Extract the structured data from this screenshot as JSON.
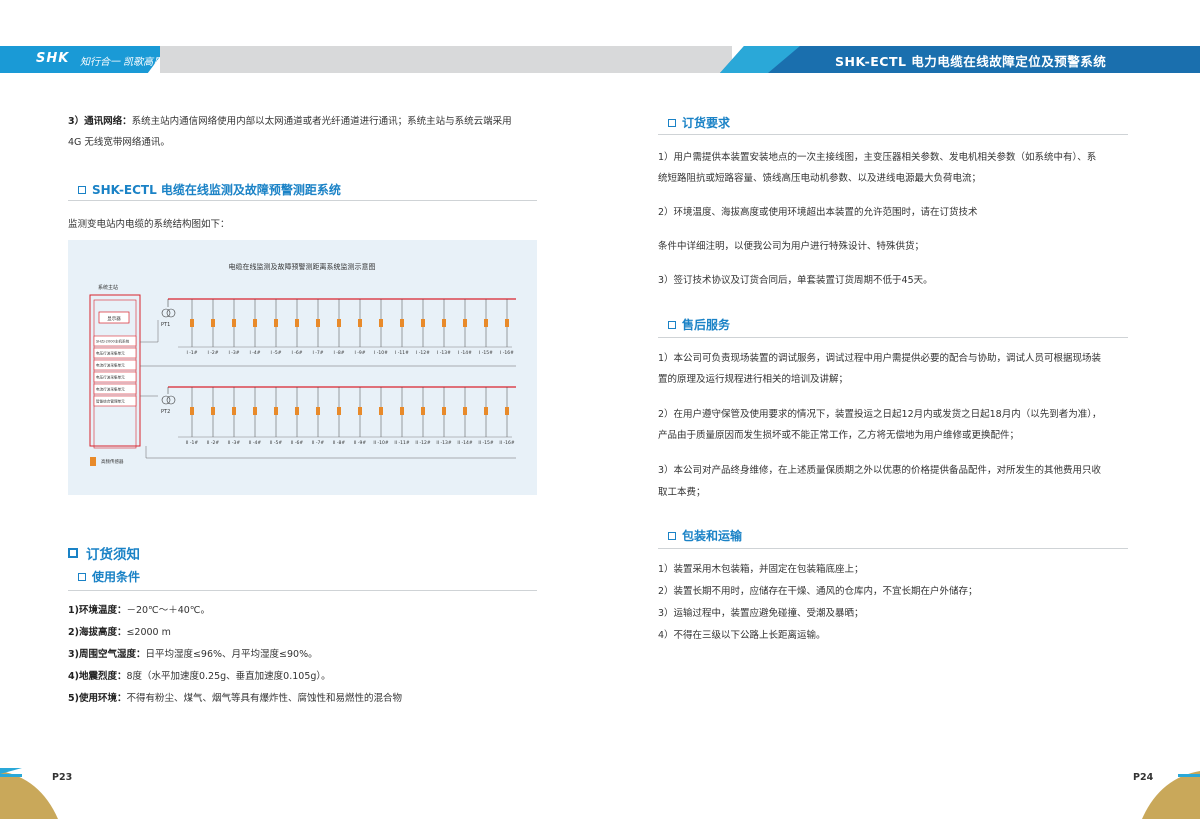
{
  "header": {
    "brand": "SHK",
    "slogan": "知行合一 凯歌高昂",
    "title": "SHK-ECTL  电力电缆在线故障定位及预警系统"
  },
  "left": {
    "comm_label": "3）通讯网络：",
    "comm_line1": "系统主站内通信网络使用内部以太网通道或者光纤通道进行通讯；系统主站与系统云端采用",
    "comm_line2": "4G 无线宽带网络通讯。",
    "section_title": "SHK-ECTL 电缆在线监测及故障预警测距系统",
    "diagram_intro": "监测变电站内电缆的系统结构图如下：",
    "diagram": {
      "title": "电缆在线监测及故障预警测距离系统监测示意图",
      "station_label": "系统主站",
      "display_label": "显示器",
      "modules": [
        "SHZJ-2000主机系统",
        "电压行波采集单元",
        "电流行波采集单元",
        "电压行波采集单元",
        "电流行波采集单元",
        "智能综合管理单元"
      ],
      "sensor_label": "高频传感器",
      "pt1": "PT1",
      "pt2": "PT2",
      "feeders_top": [
        "I -1#",
        "I -2#",
        "I -3#",
        "I -4#",
        "I -5#",
        "I -6#",
        "I -7#",
        "I -8#",
        "I -9#",
        "I -10#",
        "I -11#",
        "I -12#",
        "I -13#",
        "I -14#",
        "I -15#",
        "I -16#"
      ],
      "feeders_bottom": [
        "II -1#",
        "II -2#",
        "II -3#",
        "II -4#",
        "II -5#",
        "II -6#",
        "II -7#",
        "II -8#",
        "II -9#",
        "II -10#",
        "II -11#",
        "II -12#",
        "II -13#",
        "II -14#",
        "II -15#",
        "II -16#"
      ]
    },
    "order_notice": "订货须知",
    "usage_title": "使用条件",
    "conditions": [
      {
        "label": "1)环境温度：",
        "text": "－20℃～＋40℃。"
      },
      {
        "label": "2)海拔高度：",
        "text": "≤2000 m"
      },
      {
        "label": "3)周围空气湿度：",
        "text": "日平均湿度≤96%、月平均湿度≤90%。"
      },
      {
        "label": "4)地震烈度：",
        "text": "8度（水平加速度0.25g、垂直加速度0.105g）。"
      },
      {
        "label": "5)使用环境：",
        "text": "不得有粉尘、煤气、烟气等具有爆炸性、腐蚀性和易燃性的混合物"
      }
    ],
    "page": "P23"
  },
  "right": {
    "order_title": "订货要求",
    "order_lines": [
      "1）用户需提供本装置安装地点的一次主接线图，主变压器相关参数、发电机相关参数（如系统中有）、系",
      "统短路阻抗或短路容量、馈线高压电动机参数、以及进线电源最大负荷电流；",
      "2）环境温度、海拔高度或使用环境超出本装置的允许范围时，请在订货技术",
      "条件中详细注明，以便我公司为用户进行特殊设计、特殊供货；",
      "3）签订技术协议及订货合同后，单套装置订货周期不低于45天。"
    ],
    "service_title": "售后服务",
    "service_lines": [
      "1）本公司可负责现场装置的调试服务，调试过程中用户需提供必要的配合与协助，调试人员可根据现场装",
      "置的原理及运行规程进行相关的培训及讲解；",
      "2）在用户遵守保管及使用要求的情况下，装置投运之日起12月内或发货之日起18月内（以先到者为准），",
      "产品由于质量原因而发生损坏或不能正常工作，乙方将无偿地为用户维修或更换配件；",
      "3）本公司对产品终身维修，在上述质量保质期之外以优惠的价格提供备品配件，对所发生的其他费用只收",
      "取工本费；"
    ],
    "pack_title": "包装和运输",
    "pack_lines": [
      "1）装置采用木包装箱，并固定在包装箱底座上；",
      "2）装置长期不用时，应储存在干燥、通风的仓库内，不宜长期在户外储存；",
      "3）运输过程中，装置应避免碰撞、受潮及暴晒；",
      "4）不得在三级以下公路上长距离运输。"
    ],
    "page": "P24"
  },
  "colors": {
    "accent": "#1a82c6",
    "header_dark": "#1a6fae",
    "header_light": "#1a9ad6",
    "bus_red": "#d9232d",
    "module_orange": "#e88a2a",
    "footer_gold": "#c9a85a"
  }
}
